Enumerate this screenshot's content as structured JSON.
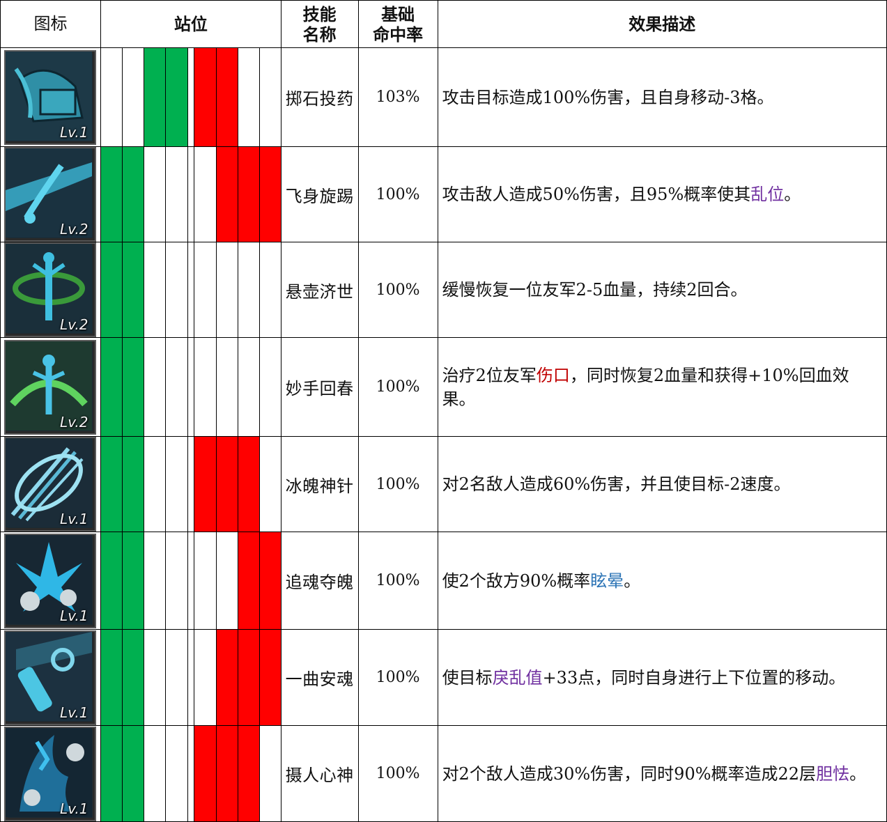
{
  "headers": {
    "icon": "图标",
    "position": "站位",
    "skill_name": "技能\n名称",
    "skill_name_l1": "技能",
    "skill_name_l2": "名称",
    "hit_rate_l1": "基础",
    "hit_rate_l2": "命中率",
    "effect": "效果描述"
  },
  "colors": {
    "ally": "#00b050",
    "enemy": "#ff0000",
    "kw_purple": "#7030a0",
    "kw_red": "#c00000",
    "kw_blue": "#2e75b6"
  },
  "skills": [
    {
      "icon": "stone-medicine-box-icon",
      "level": "Lv.1",
      "name": "掷石投药",
      "rate": "103%",
      "ally": [
        false,
        false,
        true,
        true
      ],
      "enemy": [
        true,
        true,
        false,
        false
      ],
      "desc": [
        {
          "t": "攻击目标造成100%伤害，且自身移动-3格。"
        }
      ]
    },
    {
      "icon": "flying-spin-kick-icon",
      "level": "Lv.2",
      "name": "飞身旋踢",
      "rate": "100%",
      "ally": [
        true,
        true,
        false,
        false
      ],
      "enemy": [
        false,
        true,
        true,
        true
      ],
      "desc": [
        {
          "t": "攻击敌人造成50%伤害，且95%概率使其"
        },
        {
          "t": "乱位",
          "c": "purple"
        },
        {
          "t": "。"
        }
      ]
    },
    {
      "icon": "hanging-gourd-heal-icon",
      "level": "Lv.2",
      "name": "悬壶济世",
      "rate": "100%",
      "ally": [
        true,
        true,
        false,
        false
      ],
      "enemy": [
        false,
        false,
        false,
        false
      ],
      "desc": [
        {
          "t": "缓慢恢复一位友军2-5血量，持续2回合。"
        }
      ]
    },
    {
      "icon": "miracle-hand-heal-icon",
      "level": "Lv.2",
      "name": "妙手回春",
      "rate": "100%",
      "ally": [
        true,
        true,
        false,
        false
      ],
      "enemy": [
        false,
        false,
        false,
        false
      ],
      "desc": [
        {
          "t": "治疗2位友军"
        },
        {
          "t": "伤口",
          "c": "red"
        },
        {
          "t": "，同时恢复2血量和获得+10%回血效果。"
        }
      ]
    },
    {
      "icon": "ice-soul-needle-icon",
      "level": "Lv.1",
      "name": "冰魄神针",
      "rate": "100%",
      "ally": [
        true,
        true,
        false,
        false
      ],
      "enemy": [
        true,
        true,
        true,
        false
      ],
      "desc": [
        {
          "t": "对2名敌人造成60%伤害，并且使目标-2速度。"
        }
      ]
    },
    {
      "icon": "soul-chasing-burst-icon",
      "level": "Lv.1",
      "name": "追魂夺魄",
      "rate": "100%",
      "ally": [
        true,
        true,
        false,
        false
      ],
      "enemy": [
        false,
        false,
        true,
        true
      ],
      "desc": [
        {
          "t": "使2个敌方90%概率"
        },
        {
          "t": "眩晕",
          "c": "blue"
        },
        {
          "t": "。"
        }
      ]
    },
    {
      "icon": "soul-calming-flute-icon",
      "level": "Lv.1",
      "name": "一曲安魂",
      "rate": "100%",
      "ally": [
        true,
        true,
        false,
        false
      ],
      "enemy": [
        false,
        true,
        true,
        true
      ],
      "desc": [
        {
          "t": "使目标"
        },
        {
          "t": "戾乱值",
          "c": "purple"
        },
        {
          "t": "+33点，同时自身进行上下位置的移动。"
        }
      ]
    },
    {
      "icon": "mind-capture-icon",
      "level": "Lv.1",
      "name": "摄人心神",
      "rate": "100%",
      "ally": [
        true,
        true,
        false,
        false
      ],
      "enemy": [
        true,
        true,
        true,
        false
      ],
      "desc": [
        {
          "t": "对2个敌人造成30%伤害，同时90%概率造成22层"
        },
        {
          "t": "胆怯",
          "c": "purple"
        },
        {
          "t": "。"
        }
      ]
    }
  ]
}
